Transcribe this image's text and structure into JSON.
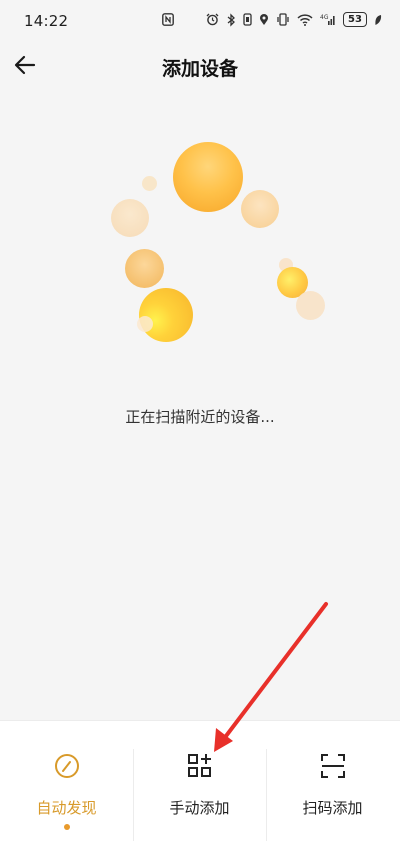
{
  "status_bar": {
    "time": "14:22",
    "battery": "53",
    "icons": [
      "nfc-icon",
      "alarm-icon",
      "bluetooth-icon",
      "vibrate-icon",
      "location-icon",
      "wifi-icon",
      "signal-icon",
      "battery-icon",
      "leaf-icon"
    ]
  },
  "header": {
    "back_icon": "arrow-left-icon",
    "title": "添加设备"
  },
  "main": {
    "scan_text": "正在扫描附近的设备..."
  },
  "tabs": [
    {
      "label": "自动发现",
      "icon": "speedometer-icon",
      "active": true
    },
    {
      "label": "手动添加",
      "icon": "grid-add-icon",
      "active": false
    },
    {
      "label": "扫码添加",
      "icon": "scan-frame-icon",
      "active": false
    }
  ],
  "colors": {
    "accent": "#d89a2a",
    "annotation_arrow": "#e8302a"
  }
}
